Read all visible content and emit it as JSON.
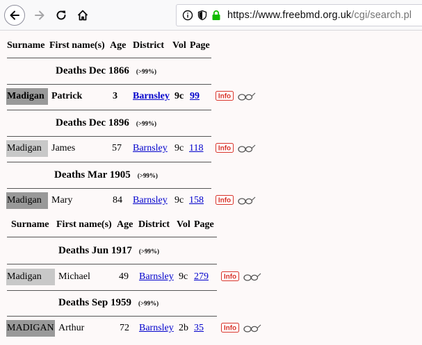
{
  "browser": {
    "url_host": "https://www.freebmd.org.uk",
    "url_path": "/cgi/search.pl"
  },
  "headers": [
    {
      "surname": "Surname",
      "first": "First name(s)",
      "age": "Age",
      "district": "District",
      "vol": "Vol",
      "page": "Page"
    },
    {
      "surname": "Surname",
      "first": "First name(s)",
      "age": "Age",
      "district": "District",
      "vol": "Vol",
      "page": "Page"
    }
  ],
  "sections": [
    {
      "title": "Deaths Dec 1866",
      "pct": "(>99%)",
      "record": {
        "surname": "Madigan",
        "first": "Patrick",
        "age": "3",
        "district": "Barnsley",
        "vol": "9c",
        "page": "99"
      }
    },
    {
      "title": "Deaths Dec 1896",
      "pct": "(>99%)",
      "record": {
        "surname": "Madigan",
        "first": "James",
        "age": "57",
        "district": "Barnsley",
        "vol": "9c",
        "page": "118"
      }
    },
    {
      "title": "Deaths Mar 1905",
      "pct": "(>99%)",
      "record": {
        "surname": "Madigan",
        "first": "Mary",
        "age": "84",
        "district": "Barnsley",
        "vol": "9c",
        "page": "158"
      }
    },
    {
      "title": "Deaths Jun 1917",
      "pct": "(>99%)",
      "record": {
        "surname": "Madigan",
        "first": "Michael",
        "age": "49",
        "district": "Barnsley",
        "vol": "9c",
        "page": "279"
      }
    },
    {
      "title": "Deaths Sep 1959",
      "pct": "(>99%)",
      "record": {
        "surname": "MADIGAN",
        "first": "Arthur",
        "age": "72",
        "district": "Barnsley",
        "vol": "2b",
        "page": "35"
      }
    }
  ],
  "icons": {
    "info": "info-icon",
    "glasses": "glasses-icon"
  },
  "colors": {
    "surname_bg_dark": "#999999",
    "surname_bg_light": "#c8c8c8",
    "link": "#0000cc",
    "info_red": "#d9342b"
  }
}
